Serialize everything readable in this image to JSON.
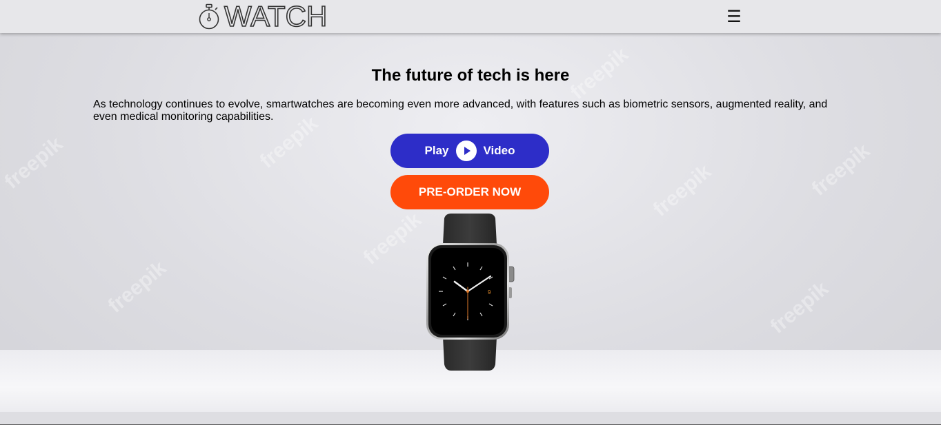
{
  "header": {
    "logo_text": "WATCH",
    "logo_icon": "stopwatch-icon",
    "menu_icon": "hamburger-menu-icon",
    "menu_glyph": "☰"
  },
  "hero": {
    "title": "The future of tech is here",
    "description": "As technology continues to evolve, smartwatches are becoming even more advanced, with features such as biometric sensors, augmented reality, and even medical monitoring capabilities.",
    "play_label_left": "Play",
    "play_icon": "play-icon",
    "play_label_right": "Video",
    "preorder_label": "PRE-ORDER NOW",
    "product_image": "smartwatch-image"
  },
  "background": {
    "watermark_text": "freepik"
  },
  "colors": {
    "play_button": "#2d2dc8",
    "preorder_button": "#ff4a0a",
    "navbar": "#e7e7ea",
    "text": "#000000"
  }
}
